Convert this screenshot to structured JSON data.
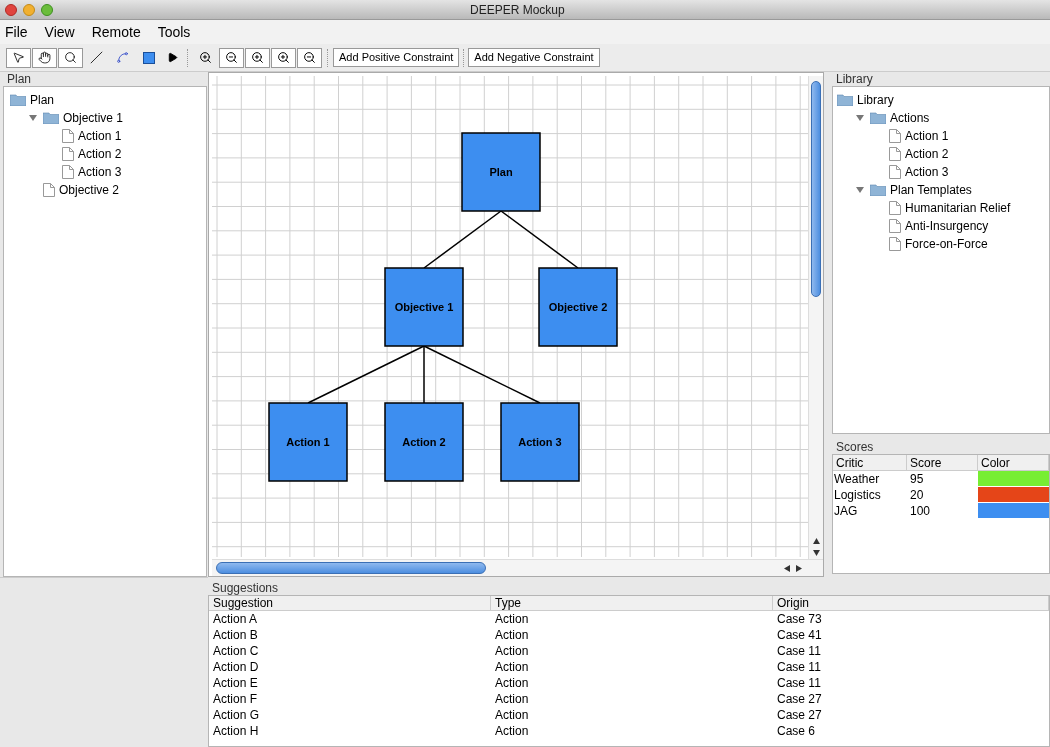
{
  "window": {
    "title": "DEEPER Mockup"
  },
  "menu": [
    "File",
    "View",
    "Remote",
    "Tools"
  ],
  "toolbar": {
    "buttons": [
      "Add Positive Constraint",
      "Add Negative Constraint"
    ]
  },
  "plan_panel": {
    "title": "Plan",
    "tree": [
      {
        "label": "Plan",
        "kind": "folder",
        "children": [
          {
            "label": "Objective 1",
            "kind": "folder",
            "expanded": true,
            "children": [
              {
                "label": "Action 1",
                "kind": "document"
              },
              {
                "label": "Action 2",
                "kind": "document"
              },
              {
                "label": "Action 3",
                "kind": "document"
              }
            ]
          },
          {
            "label": "Objective 2",
            "kind": "document"
          }
        ]
      }
    ]
  },
  "diagram": {
    "root": {
      "label": "Plan",
      "children": [
        {
          "label": "Objective 1",
          "children": [
            {
              "label": "Action 1"
            },
            {
              "label": "Action 2"
            },
            {
              "label": "Action 3"
            }
          ]
        },
        {
          "label": "Objective 2"
        }
      ]
    }
  },
  "library_panel": {
    "title": "Library",
    "tree": [
      {
        "label": "Library",
        "kind": "folder",
        "children": [
          {
            "label": "Actions",
            "kind": "folder",
            "expanded": true,
            "children": [
              {
                "label": "Action 1",
                "kind": "document"
              },
              {
                "label": "Action 2",
                "kind": "document"
              },
              {
                "label": "Action 3",
                "kind": "document"
              }
            ]
          },
          {
            "label": "Plan Templates",
            "kind": "folder",
            "expanded": true,
            "children": [
              {
                "label": "Humanitarian Relief",
                "kind": "document"
              },
              {
                "label": "Anti-Insurgency",
                "kind": "document"
              },
              {
                "label": "Force-on-Force",
                "kind": "document"
              }
            ]
          }
        ]
      }
    ]
  },
  "scores": {
    "title": "Scores",
    "columns": [
      "Critic",
      "Score",
      "Color"
    ],
    "rows": [
      {
        "critic": "Weather",
        "score": "95",
        "color": "#77ee33"
      },
      {
        "critic": "Logistics",
        "score": "20",
        "color": "#e54518"
      },
      {
        "critic": "JAG",
        "score": "100",
        "color": "#3d8ef0"
      }
    ]
  },
  "suggestions": {
    "title": "Suggestions",
    "columns": [
      "Suggestion",
      "Type",
      "Origin"
    ],
    "rows": [
      [
        "Action A",
        "Action",
        "Case 73"
      ],
      [
        "Action B",
        "Action",
        "Case 41"
      ],
      [
        "Action C",
        "Action",
        "Case 11"
      ],
      [
        "Action D",
        "Action",
        "Case 11"
      ],
      [
        "Action E",
        "Action",
        "Case 11"
      ],
      [
        "Action F",
        "Action",
        "Case 27"
      ],
      [
        "Action G",
        "Action",
        "Case 27"
      ],
      [
        "Action H",
        "Action",
        "Case 6"
      ]
    ]
  }
}
